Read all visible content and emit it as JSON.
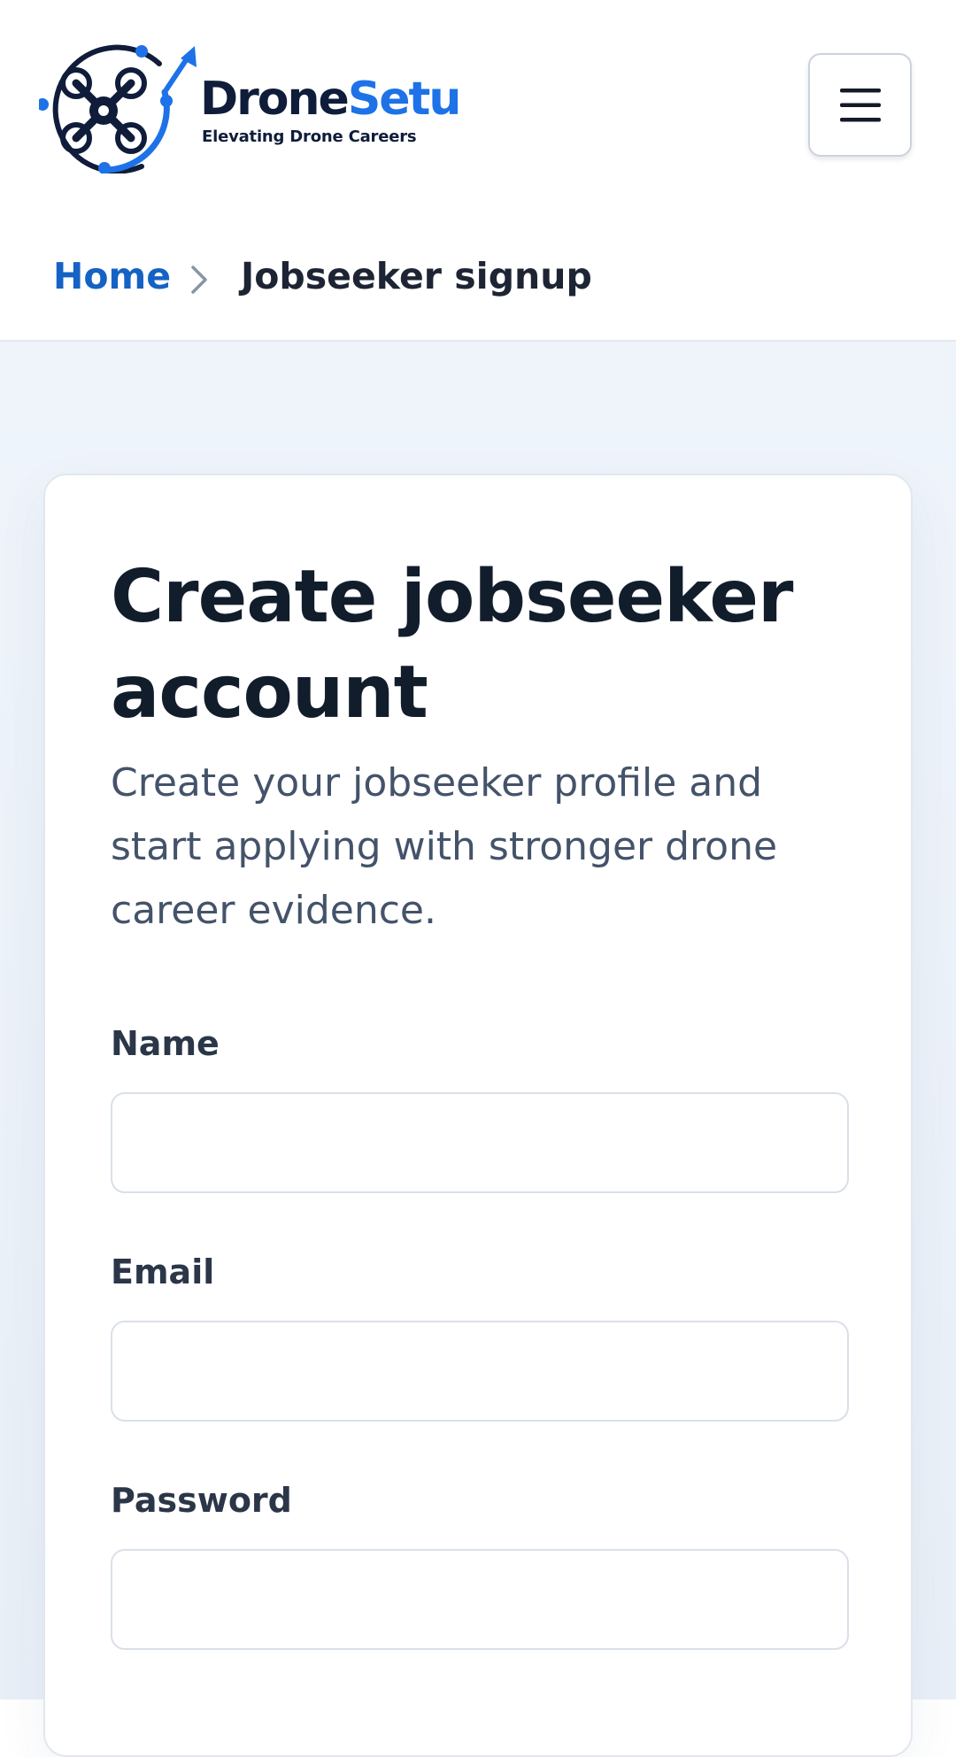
{
  "brand": {
    "name_part1": "Drone",
    "name_part2": "Setu",
    "tagline": "Elevating Drone Careers",
    "colors": {
      "navy": "#0f1d3a",
      "blue": "#1d72e8"
    }
  },
  "header": {
    "menu_icon": "hamburger-menu-icon"
  },
  "breadcrumb": {
    "home": "Home",
    "separator_icon": "chevron-right-icon",
    "current": "Jobseeker signup"
  },
  "form": {
    "title": "Create jobseeker account",
    "subtitle": "Create your jobseeker profile and start applying with stronger drone career evidence.",
    "fields": [
      {
        "label": "Name",
        "value": ""
      },
      {
        "label": "Email",
        "value": ""
      },
      {
        "label": "Password",
        "value": ""
      }
    ]
  }
}
